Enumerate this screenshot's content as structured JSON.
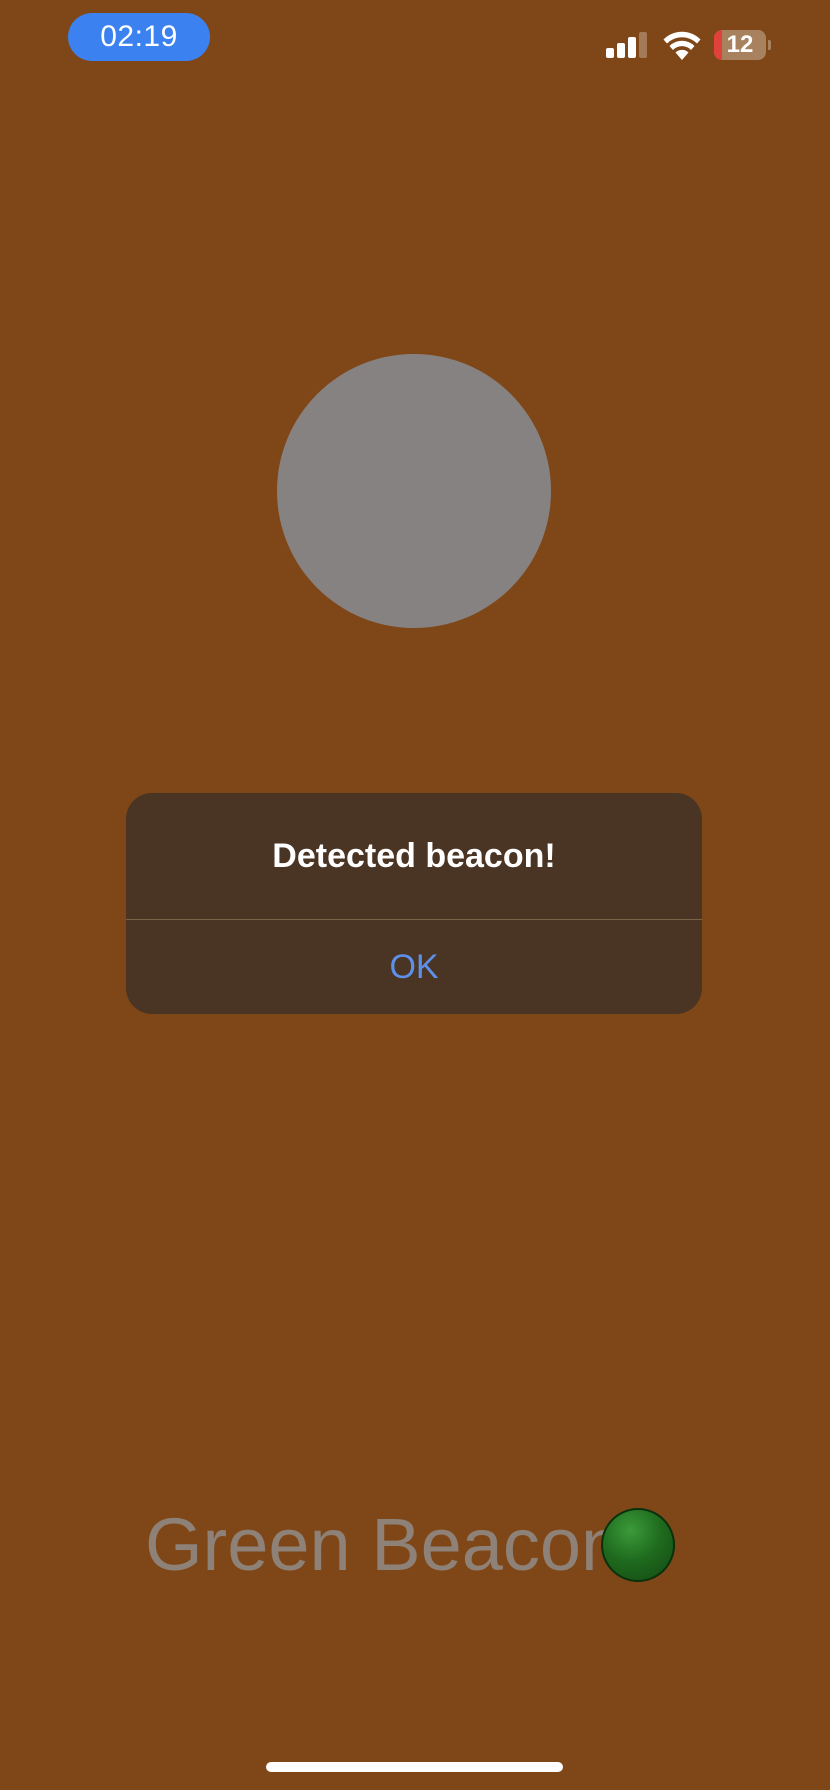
{
  "status_bar": {
    "time": "02:19",
    "battery_level": "12",
    "signal_icon": "cellular-signal-icon",
    "wifi_icon": "wifi-icon",
    "battery_icon": "battery-icon"
  },
  "alert": {
    "title": "Detected beacon!",
    "ok_label": "OK"
  },
  "main": {
    "beacon_label": "Green Beacon",
    "beacon_indicator_icon": "green-circle-icon"
  },
  "colors": {
    "background": "#7f4718",
    "circle": "#878282",
    "alert_background": "#4a3423",
    "alert_button": "#5d90ea",
    "time_pill": "#3b82f0",
    "beacon_dot": "#1f6b1e"
  }
}
